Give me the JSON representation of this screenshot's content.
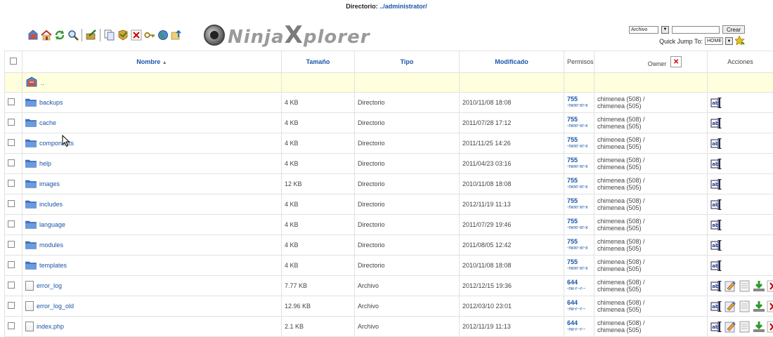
{
  "header": {
    "label": "Directorio:",
    "path": "../administrator/"
  },
  "toolbar": {
    "icons": [
      "home-back-icon",
      "house-icon",
      "refresh-icon",
      "search-icon",
      "separator",
      "edit-tool-icon",
      "separator",
      "copy-icon",
      "move-icon",
      "delete-icon",
      "key-icon",
      "globe-icon",
      "upload-icon"
    ]
  },
  "logo": {
    "part1": "Ninja",
    "part2": "X",
    "part3": "plorer"
  },
  "create": {
    "type_value": "Archivo",
    "button_label": "Crear"
  },
  "quick_jump": {
    "label": "Quick Jump To:",
    "value": "HOME"
  },
  "columns": {
    "name": "Nombre",
    "size": "Tamaño",
    "type": "Tipo",
    "modified": "Modificado",
    "perms": "Permisos",
    "owner": "Owner",
    "actions": "Acciones"
  },
  "parent_row": {
    "label": ".."
  },
  "rows": [
    {
      "name": "backups",
      "kind": "folder",
      "size": "4 KB",
      "type": "Directorio",
      "modified": "2010/11/08 18:08",
      "perm": "755",
      "perm_str": "-rwxr-xr-x",
      "owner1": "chimenea (508) /",
      "owner2": "chimenea (505)"
    },
    {
      "name": "cache",
      "kind": "folder",
      "size": "4 KB",
      "type": "Directorio",
      "modified": "2011/07/28 17:12",
      "perm": "755",
      "perm_str": "-rwxr-xr-x",
      "owner1": "chimenea (508) /",
      "owner2": "chimenea (505)"
    },
    {
      "name": "components",
      "kind": "folder",
      "size": "4 KB",
      "type": "Directorio",
      "modified": "2011/11/25 14:26",
      "perm": "755",
      "perm_str": "-rwxr-xr-x",
      "owner1": "chimenea (508) /",
      "owner2": "chimenea (505)"
    },
    {
      "name": "help",
      "kind": "folder",
      "size": "4 KB",
      "type": "Directorio",
      "modified": "2011/04/23 03:16",
      "perm": "755",
      "perm_str": "-rwxr-xr-x",
      "owner1": "chimenea (508) /",
      "owner2": "chimenea (505)"
    },
    {
      "name": "images",
      "kind": "folder",
      "size": "12 KB",
      "type": "Directorio",
      "modified": "2010/11/08 18:08",
      "perm": "755",
      "perm_str": "-rwxr-xr-x",
      "owner1": "chimenea (508) /",
      "owner2": "chimenea (505)"
    },
    {
      "name": "includes",
      "kind": "folder",
      "size": "4 KB",
      "type": "Directorio",
      "modified": "2012/11/19 11:13",
      "perm": "755",
      "perm_str": "-rwxr-xr-x",
      "owner1": "chimenea (508) /",
      "owner2": "chimenea (505)"
    },
    {
      "name": "language",
      "kind": "folder",
      "size": "4 KB",
      "type": "Directorio",
      "modified": "2011/07/29 19:46",
      "perm": "755",
      "perm_str": "-rwxr-xr-x",
      "owner1": "chimenea (508) /",
      "owner2": "chimenea (505)"
    },
    {
      "name": "modules",
      "kind": "folder",
      "size": "4 KB",
      "type": "Directorio",
      "modified": "2011/08/05 12:42",
      "perm": "755",
      "perm_str": "-rwxr-xr-x",
      "owner1": "chimenea (508) /",
      "owner2": "chimenea (505)"
    },
    {
      "name": "templates",
      "kind": "folder",
      "size": "4 KB",
      "type": "Directorio",
      "modified": "2010/11/08 18:08",
      "perm": "755",
      "perm_str": "-rwxr-xr-x",
      "owner1": "chimenea (508) /",
      "owner2": "chimenea (505)"
    },
    {
      "name": "error_log",
      "kind": "file",
      "size": "7.77 KB",
      "type": "Archivo",
      "modified": "2012/12/15 19:36",
      "perm": "644",
      "perm_str": "-rw-r--r--",
      "owner1": "chimenea (508) /",
      "owner2": "chimenea (505)"
    },
    {
      "name": "error_log_old",
      "kind": "file",
      "size": "12.96 KB",
      "type": "Archivo",
      "modified": "2012/03/10 23:01",
      "perm": "644",
      "perm_str": "-rw-r--r--",
      "owner1": "chimenea (508) /",
      "owner2": "chimenea (505)"
    },
    {
      "name": "index.php",
      "kind": "file",
      "size": "2.1 KB",
      "type": "Archivo",
      "modified": "2012/11/19 11:13",
      "perm": "644",
      "perm_str": "-rw-r--r--",
      "owner1": "chimenea (508) /",
      "owner2": "chimenea (505)"
    }
  ],
  "colors": {
    "link": "#1a55a8",
    "parent_row_bg": "#ffffdd",
    "folder": "#4f86d6"
  }
}
